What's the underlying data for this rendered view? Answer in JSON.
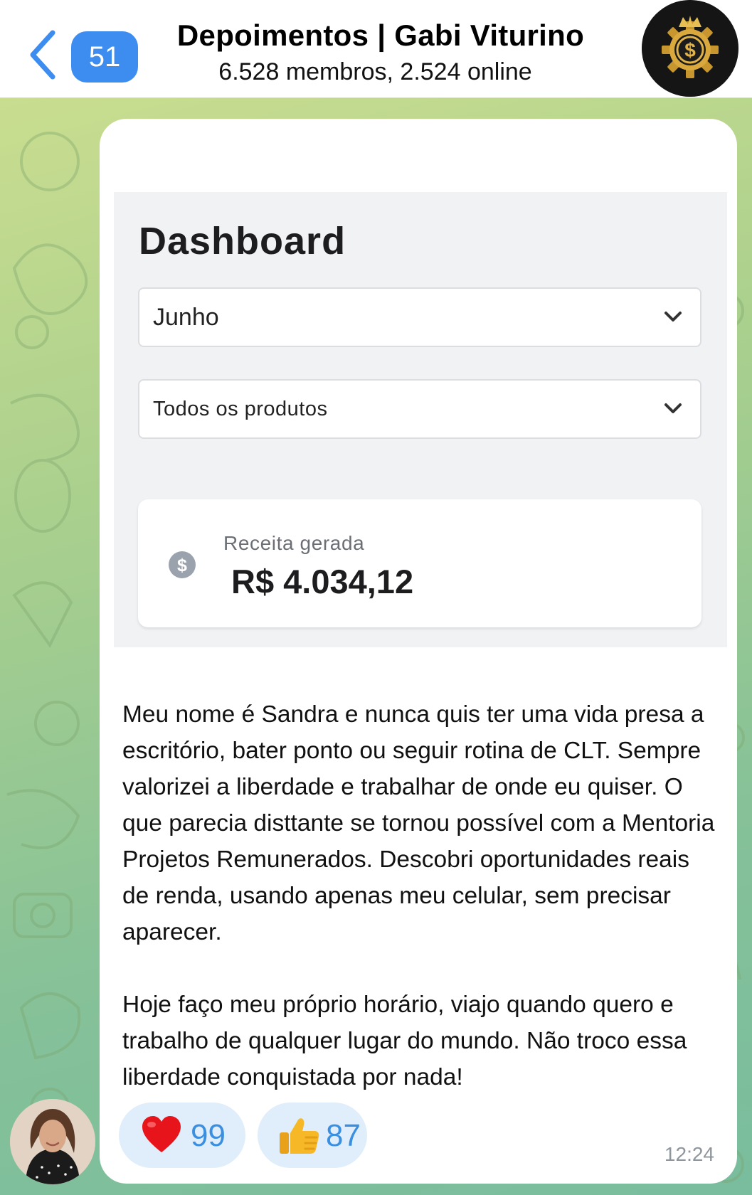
{
  "header": {
    "back_icon": "chevron-left-icon",
    "unread_count": "51",
    "title": "Depoimentos | Gabi Viturino",
    "subtitle": "6.528 membros, 2.524 online",
    "avatar_icon": "dollar-gear-crown-icon"
  },
  "message": {
    "screenshot": {
      "title": "Dashboard",
      "month_select": "Junho",
      "product_select": "Todos os produtos",
      "revenue_label": "Receita gerada",
      "revenue_value": "R$ 4.034,12",
      "revenue_icon": "dollar-circle-icon"
    },
    "paragraphs": [
      "Meu nome é Sandra e nunca quis ter uma vida presa a escritório, bater ponto ou seguir rotina de CLT. Sempre valorizei a liberdade e trabalhar de onde eu quiser. O que parecia disttante se tornou possível com a Mentoria Projetos Remunerados. Descobri oportunidades reais de renda, usando apenas meu celular, sem precisar aparecer.",
      "Hoje faço meu próprio horário, viajo quando quero e trabalho de qualquer lugar do mundo. Não troco essa liberdade conquistada por nada!"
    ],
    "reactions": [
      {
        "emoji": "heart-icon",
        "count": "99"
      },
      {
        "emoji": "thumbs-up-icon",
        "count": "87"
      }
    ],
    "time": "12:24",
    "sender_avatar": "profile-photo"
  },
  "colors": {
    "accent": "#3d8df0",
    "reaction_bg": "#dfeefa",
    "reaction_count": "#3b8fe0",
    "heart": "#e8141c",
    "thumbs": "#f6b826"
  }
}
